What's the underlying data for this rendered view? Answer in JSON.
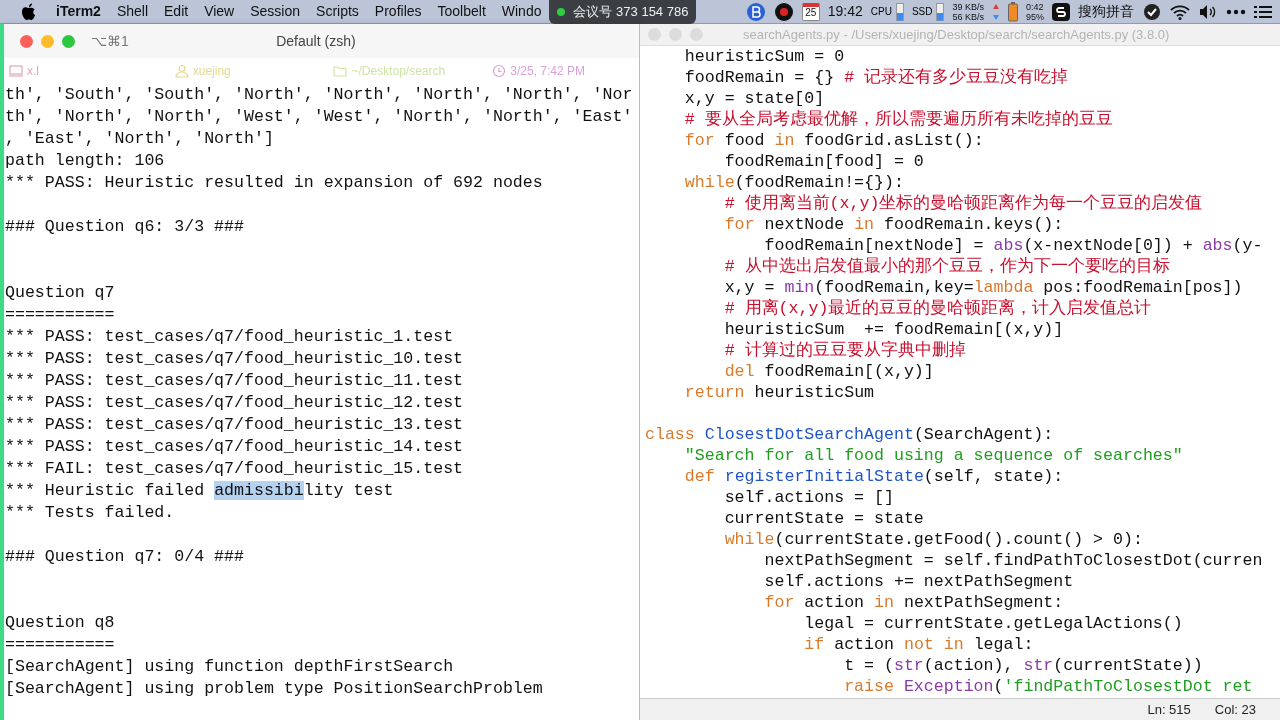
{
  "menu_bar": {
    "app_name": "iTerm2",
    "menus": [
      "Shell",
      "Edit",
      "View",
      "Session",
      "Scripts",
      "Profiles",
      "Toolbelt",
      "Windo"
    ],
    "meeting_badge": "会议号 373 154 786",
    "status": {
      "date_day": "25",
      "clock": "19:42",
      "cpu_label": "CPU",
      "ssd_label": "SSD",
      "upload": "39 KB/s",
      "download": "56 KB/s",
      "battery_time": "0:42",
      "battery_percent": "95%",
      "input_method": "搜狗拼音"
    }
  },
  "terminal": {
    "shortcut": "⌥⌘1",
    "title": "Default (zsh)",
    "status": [
      {
        "kind": "host",
        "text": "x.l",
        "color": "#e0a6b4"
      },
      {
        "kind": "user",
        "text": "xuejing",
        "color": "#e6d890"
      },
      {
        "kind": "dir",
        "text": "~/Desktop/search",
        "color": "#cfe3a4"
      },
      {
        "kind": "time",
        "text": "3/25, 7:42 PM",
        "color": "#d9a0d6"
      }
    ],
    "lines": [
      {
        "kind": "text",
        "text": "th', 'South', 'South', 'North', 'North', 'North', 'North', 'Nor"
      },
      {
        "kind": "text",
        "text": "th', 'North', 'North', 'West', 'West', 'North', 'North', 'East'"
      },
      {
        "kind": "text",
        "text": ", 'East', 'North', 'North']"
      },
      {
        "kind": "text",
        "text": "path length: 106"
      },
      {
        "kind": "text",
        "text": "*** PASS: Heuristic resulted in expansion of 692 nodes"
      },
      {
        "kind": "blank"
      },
      {
        "kind": "text",
        "text": "### Question q6: 3/3 ###"
      },
      {
        "kind": "blank"
      },
      {
        "kind": "blank"
      },
      {
        "kind": "text",
        "text": "Question q7"
      },
      {
        "kind": "text",
        "text": "==========="
      },
      {
        "kind": "text",
        "text": "*** PASS: test_cases/q7/food_heuristic_1.test"
      },
      {
        "kind": "text",
        "text": "*** PASS: test_cases/q7/food_heuristic_10.test"
      },
      {
        "kind": "text",
        "text": "*** PASS: test_cases/q7/food_heuristic_11.test"
      },
      {
        "kind": "text",
        "text": "*** PASS: test_cases/q7/food_heuristic_12.test"
      },
      {
        "kind": "text",
        "text": "*** PASS: test_cases/q7/food_heuristic_13.test"
      },
      {
        "kind": "text",
        "text": "*** PASS: test_cases/q7/food_heuristic_14.test"
      },
      {
        "kind": "text",
        "text": "*** FAIL: test_cases/q7/food_heuristic_15.test"
      },
      {
        "kind": "split",
        "segments": [
          {
            "text": "*** Heuristic failed ",
            "selected": false
          },
          {
            "text": "admissibi",
            "selected": true
          },
          {
            "text": "lity test",
            "selected": false
          }
        ]
      },
      {
        "kind": "text",
        "text": "*** Tests failed."
      },
      {
        "kind": "blank"
      },
      {
        "kind": "text",
        "text": "### Question q7: 0/4 ###"
      },
      {
        "kind": "blank"
      },
      {
        "kind": "blank"
      },
      {
        "kind": "text",
        "text": "Question q8"
      },
      {
        "kind": "text",
        "text": "==========="
      },
      {
        "kind": "text",
        "text": "[SearchAgent] using function depthFirstSearch"
      },
      {
        "kind": "text",
        "text": "[SearchAgent] using problem type PositionSearchProblem"
      }
    ]
  },
  "editor": {
    "title": "searchAgents.py - /Users/xuejing/Desktop/search/searchAgents.py (3.8.0)",
    "lines": [
      {
        "kind": "code",
        "tokens": [
          {
            "kind": "plain",
            "text": "    heuristicSum = 0"
          }
        ]
      },
      {
        "kind": "code",
        "tokens": [
          {
            "kind": "plain",
            "text": "    foodRemain = {} "
          },
          {
            "kind": "comment",
            "text": "# 记录还有多少豆豆没有吃掉"
          }
        ]
      },
      {
        "kind": "code",
        "tokens": [
          {
            "kind": "plain",
            "text": "    x,y = state[0]"
          }
        ]
      },
      {
        "kind": "code",
        "tokens": [
          {
            "kind": "comment",
            "text": "    # 要从全局考虑最优解，所以需要遍历所有未吃掉的豆豆"
          }
        ]
      },
      {
        "kind": "code",
        "tokens": [
          {
            "kind": "keyword",
            "text": "    for"
          },
          {
            "kind": "plain",
            "text": " food "
          },
          {
            "kind": "keyword",
            "text": "in"
          },
          {
            "kind": "plain",
            "text": " foodGrid.asList():"
          }
        ]
      },
      {
        "kind": "code",
        "tokens": [
          {
            "kind": "plain",
            "text": "        foodRemain[food] = 0"
          }
        ]
      },
      {
        "kind": "code",
        "tokens": [
          {
            "kind": "keyword",
            "text": "    while"
          },
          {
            "kind": "plain",
            "text": "(foodRemain!={}):"
          }
        ]
      },
      {
        "kind": "code",
        "tokens": [
          {
            "kind": "comment",
            "text": "        # 使用离当前(x,y)坐标的曼哈顿距离作为每一个豆豆的启发值"
          }
        ]
      },
      {
        "kind": "code",
        "tokens": [
          {
            "kind": "keyword",
            "text": "        for"
          },
          {
            "kind": "plain",
            "text": " nextNode "
          },
          {
            "kind": "keyword",
            "text": "in"
          },
          {
            "kind": "plain",
            "text": " foodRemain.keys():"
          }
        ]
      },
      {
        "kind": "code",
        "tokens": [
          {
            "kind": "plain",
            "text": "            foodRemain[nextNode] = "
          },
          {
            "kind": "builtin",
            "text": "abs"
          },
          {
            "kind": "plain",
            "text": "(x-nextNode[0]) + "
          },
          {
            "kind": "builtin",
            "text": "abs"
          },
          {
            "kind": "plain",
            "text": "(y-"
          }
        ]
      },
      {
        "kind": "code",
        "tokens": [
          {
            "kind": "comment",
            "text": "        # 从中选出启发值最小的那个豆豆，作为下一个要吃的目标"
          }
        ]
      },
      {
        "kind": "code",
        "tokens": [
          {
            "kind": "plain",
            "text": "        x,y = "
          },
          {
            "kind": "builtin",
            "text": "min"
          },
          {
            "kind": "plain",
            "text": "(foodRemain,key="
          },
          {
            "kind": "keyword",
            "text": "lambda"
          },
          {
            "kind": "plain",
            "text": " pos:foodRemain[pos])"
          }
        ]
      },
      {
        "kind": "code",
        "tokens": [
          {
            "kind": "comment",
            "text": "        # 用离(x,y)最近的豆豆的曼哈顿距离，计入启发值总计"
          }
        ]
      },
      {
        "kind": "code",
        "tokens": [
          {
            "kind": "plain",
            "text": "        heuristicSum  += foodRemain[(x,y)]"
          }
        ]
      },
      {
        "kind": "code",
        "tokens": [
          {
            "kind": "comment",
            "text": "        # 计算过的豆豆要从字典中删掉"
          }
        ]
      },
      {
        "kind": "code",
        "tokens": [
          {
            "kind": "keyword",
            "text": "        del"
          },
          {
            "kind": "plain",
            "text": " foodRemain[(x,y)]"
          }
        ]
      },
      {
        "kind": "code",
        "tokens": [
          {
            "kind": "keyword",
            "text": "    return"
          },
          {
            "kind": "plain",
            "text": " heuristicSum"
          }
        ]
      },
      {
        "kind": "blank"
      },
      {
        "kind": "code",
        "tokens": [
          {
            "kind": "keyword",
            "text": "class"
          },
          {
            "kind": "name",
            "text": " ClosestDotSearchAgent"
          },
          {
            "kind": "plain",
            "text": "(SearchAgent):"
          }
        ]
      },
      {
        "kind": "code",
        "tokens": [
          {
            "kind": "string",
            "text": "    \"Search for all food using a sequence of searches\""
          }
        ]
      },
      {
        "kind": "code",
        "tokens": [
          {
            "kind": "keyword",
            "text": "    def"
          },
          {
            "kind": "name",
            "text": " registerInitialState"
          },
          {
            "kind": "plain",
            "text": "(self, state):"
          }
        ]
      },
      {
        "kind": "code",
        "tokens": [
          {
            "kind": "plain",
            "text": "        self.actions = []"
          }
        ]
      },
      {
        "kind": "code",
        "tokens": [
          {
            "kind": "plain",
            "text": "        currentState = state"
          }
        ]
      },
      {
        "kind": "code",
        "tokens": [
          {
            "kind": "keyword",
            "text": "        while"
          },
          {
            "kind": "plain",
            "text": "(currentState.getFood().count() > 0):"
          }
        ]
      },
      {
        "kind": "code",
        "tokens": [
          {
            "kind": "plain",
            "text": "            nextPathSegment = self.findPathToClosestDot(curren"
          }
        ]
      },
      {
        "kind": "code",
        "tokens": [
          {
            "kind": "plain",
            "text": "            self.actions += nextPathSegment"
          }
        ]
      },
      {
        "kind": "code",
        "tokens": [
          {
            "kind": "keyword",
            "text": "            for"
          },
          {
            "kind": "plain",
            "text": " action "
          },
          {
            "kind": "keyword",
            "text": "in"
          },
          {
            "kind": "plain",
            "text": " nextPathSegment:"
          }
        ]
      },
      {
        "kind": "code",
        "tokens": [
          {
            "kind": "plain",
            "text": "                legal = currentState.getLegalActions()"
          }
        ]
      },
      {
        "kind": "code",
        "tokens": [
          {
            "kind": "keyword",
            "text": "                if"
          },
          {
            "kind": "plain",
            "text": " action "
          },
          {
            "kind": "keyword",
            "text": "not in"
          },
          {
            "kind": "plain",
            "text": " legal:"
          }
        ]
      },
      {
        "kind": "code",
        "tokens": [
          {
            "kind": "plain",
            "text": "                    t = ("
          },
          {
            "kind": "builtin",
            "text": "str"
          },
          {
            "kind": "plain",
            "text": "(action), "
          },
          {
            "kind": "builtin",
            "text": "str"
          },
          {
            "kind": "plain",
            "text": "(currentState))"
          }
        ]
      },
      {
        "kind": "code",
        "tokens": [
          {
            "kind": "keyword",
            "text": "                    raise"
          },
          {
            "kind": "builtin",
            "text": " Exception"
          },
          {
            "kind": "plain",
            "text": "("
          },
          {
            "kind": "string",
            "text": "'findPathToClosestDot ret"
          }
        ]
      }
    ],
    "status": {
      "line": "Ln: 515",
      "column": "Col: 23"
    }
  }
}
